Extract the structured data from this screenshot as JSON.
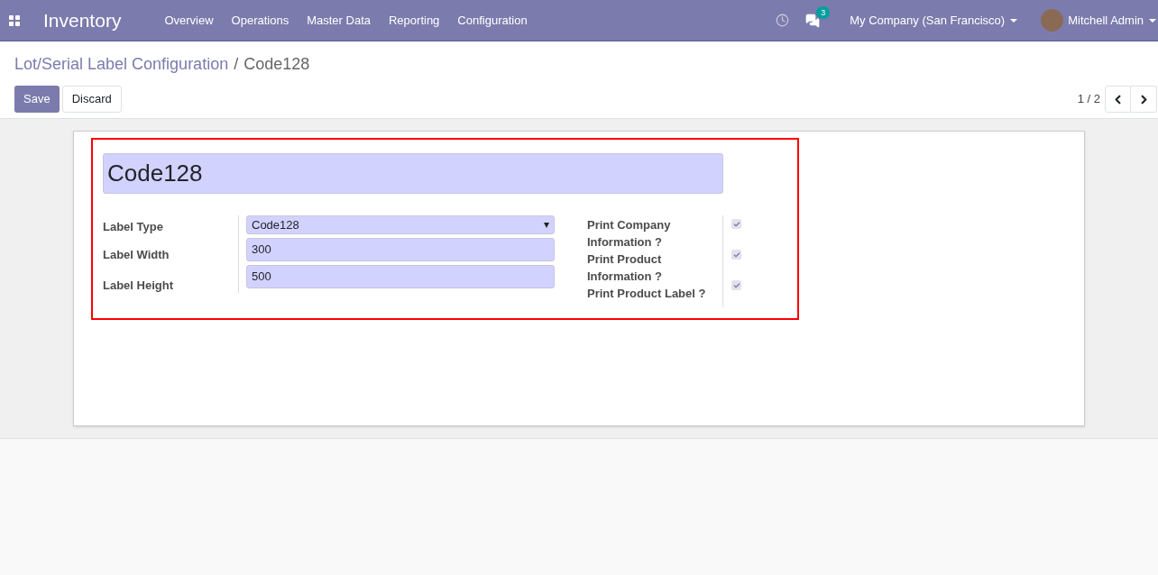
{
  "navbar": {
    "app_name": "Inventory",
    "menu": [
      "Overview",
      "Operations",
      "Master Data",
      "Reporting",
      "Configuration"
    ],
    "messages_badge": "3",
    "company": "My Company (San Francisco)",
    "user": "Mitchell Admin"
  },
  "breadcrumb": {
    "parent": "Lot/Serial Label Configuration",
    "separator": "/",
    "current": "Code128"
  },
  "buttons": {
    "save": "Save",
    "discard": "Discard"
  },
  "pager": "1 / 2",
  "form": {
    "name": "Code128",
    "fields": [
      {
        "label": "Label Type",
        "kind": "select",
        "value": "Code128"
      },
      {
        "label": "Label Width",
        "kind": "text",
        "value": "300"
      },
      {
        "label": "Label Height",
        "kind": "text",
        "value": "500"
      }
    ],
    "checkboxes": [
      {
        "label": "Print Company Information ?",
        "checked": true
      },
      {
        "label": "Print Product Information ?",
        "checked": true
      },
      {
        "label": "Print Product Label ?",
        "checked": true
      }
    ]
  }
}
